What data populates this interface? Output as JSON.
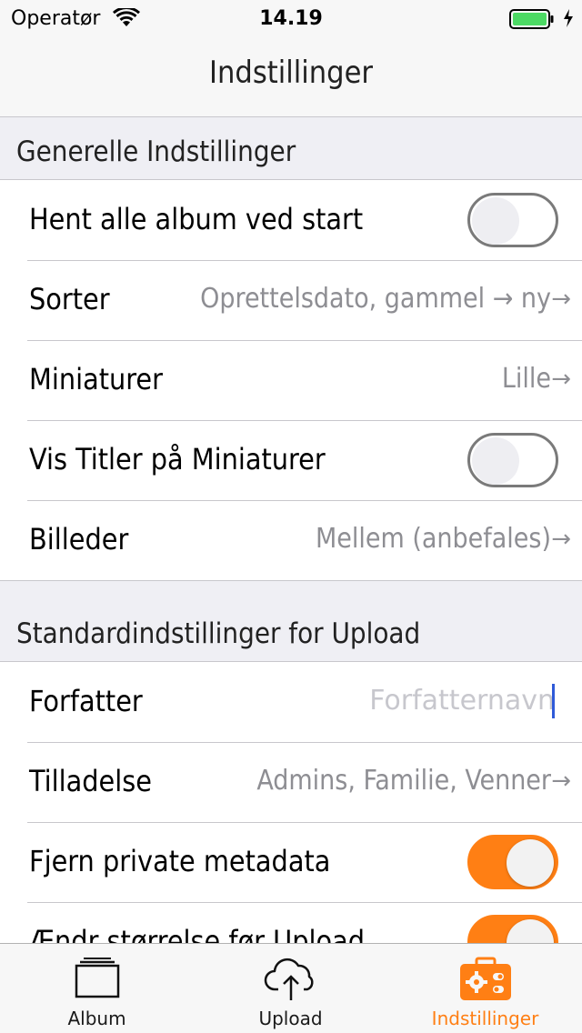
{
  "status_bar": {
    "carrier": "Operatør",
    "time": "14.19"
  },
  "nav": {
    "title": "Indstillinger"
  },
  "sections": {
    "general": {
      "header": "Generelle Indstillinger",
      "rows": {
        "load_all": {
          "label": "Hent alle album ved start",
          "toggle_on": false
        },
        "sort": {
          "label": "Sorter",
          "value": "Oprettelsdato, gammel → ny"
        },
        "thumbnails": {
          "label": "Miniaturer",
          "value": "Lille"
        },
        "show_titles": {
          "label": "Vis Titler på Miniaturer",
          "toggle_on": false
        },
        "images": {
          "label": "Billeder",
          "value": "Mellem (anbefales)"
        }
      }
    },
    "upload": {
      "header": "Standardindstillinger for Upload",
      "rows": {
        "author": {
          "label": "Forfatter",
          "placeholder": "Forfatternavn"
        },
        "permission": {
          "label": "Tilladelse",
          "value": "Admins, Familie, Venner"
        },
        "strip_metadata": {
          "label": "Fjern private metadata",
          "toggle_on": true
        },
        "resize": {
          "label": "Ændr størrelse før Upload",
          "toggle_on": true
        }
      }
    }
  },
  "tabs": [
    {
      "label": "Album",
      "icon": "album-icon",
      "active": false
    },
    {
      "label": "Upload",
      "icon": "cloud-upload-icon",
      "active": false
    },
    {
      "label": "Indstillinger",
      "icon": "settings-toolbox-icon",
      "active": true
    }
  ],
  "colors": {
    "accent": "#ff7f14",
    "secondary_text": "#8e8e93",
    "separator": "#c8c7cc"
  }
}
